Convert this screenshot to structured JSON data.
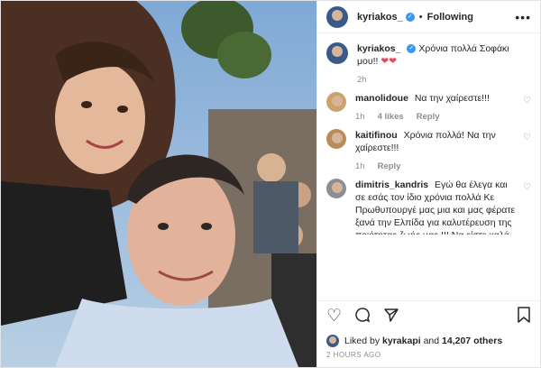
{
  "post": {
    "author": "kyriakos_",
    "follow_state": "Following",
    "separator": "•",
    "more_icon": "more-horizontal-icon",
    "verified_glyph": "✓",
    "caption": {
      "username": "kyriakos_",
      "text": "Χρόνια πολλά Σοφάκι μου!!",
      "emoji": "❤❤",
      "age": "2h"
    },
    "comments": [
      {
        "username": "manolidoue",
        "text": "Να την χαίρεστε!!!",
        "age": "1h",
        "likes": "4 likes",
        "reply": "Reply"
      },
      {
        "username": "kaitifinou",
        "text": "Χρόνια πολλά! Να την χαίρεστε!!!",
        "age": "1h",
        "reply": "Reply"
      },
      {
        "username": "dimitris_kandris",
        "text": "Εγώ θα έλεγα και σε εσάς τον ίδιο χρόνια πολλά Κε Πρωθυπουργέ μας μια και μας φέρατε ξανά την Ελπίδα για καλυτέρευση της ποιότητας ζωής μας !!! Να είστε καλά και να"
      }
    ],
    "liked_by": {
      "prefix": "Liked by",
      "user": "kyrakapi",
      "conjunction": "and",
      "count": "14,207 others"
    },
    "timestamp": "2 HOURS AGO"
  },
  "icons": {
    "like": "heart-icon",
    "comment": "comment-icon",
    "share": "share-icon",
    "save": "bookmark-icon"
  },
  "colors": {
    "verified": "#3897f0",
    "like_red": "#ed4956",
    "muted": "#8e8e8e"
  }
}
